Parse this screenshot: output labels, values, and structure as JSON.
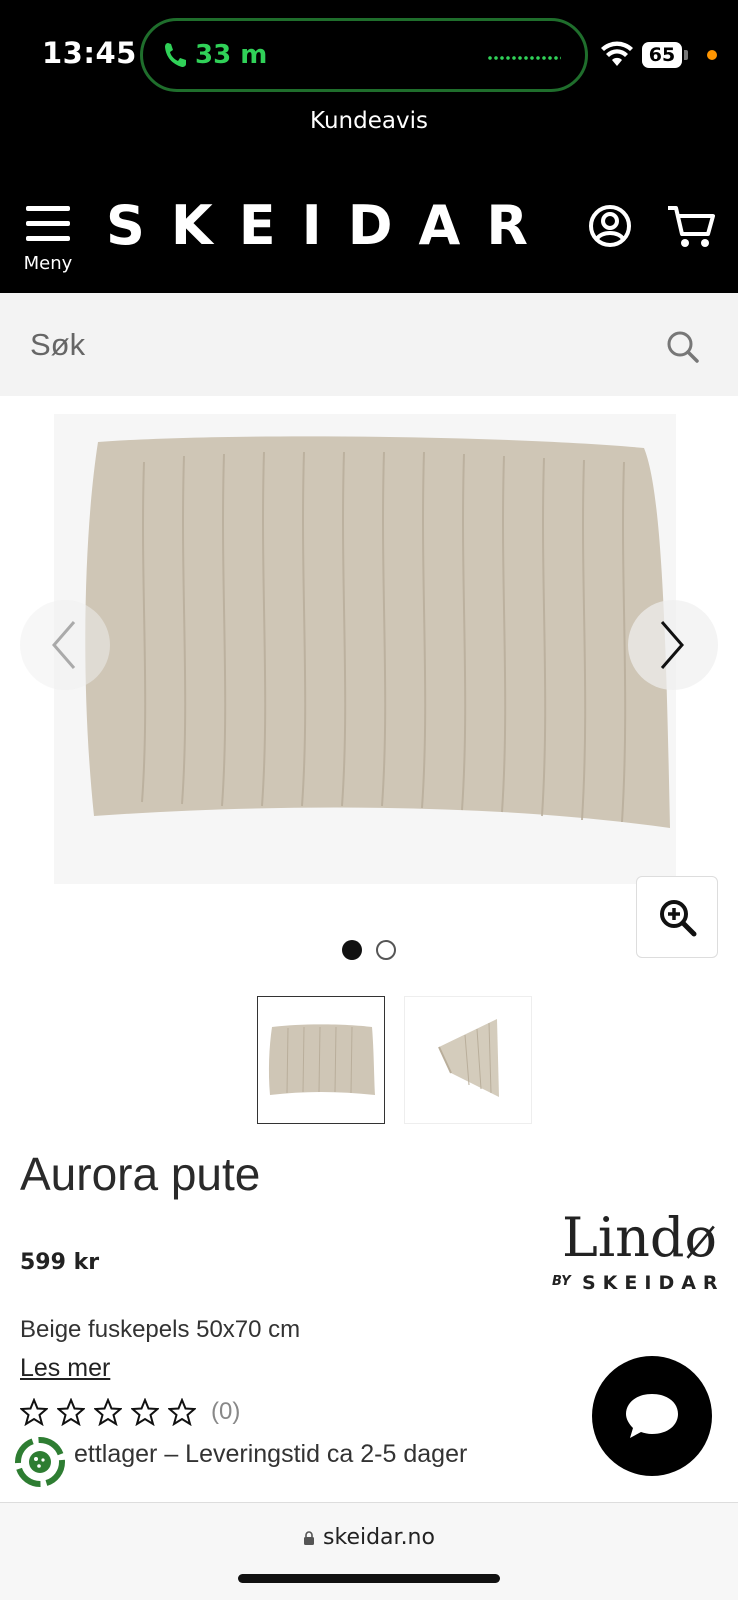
{
  "status_bar": {
    "time": "13:45",
    "call_duration": "33 m",
    "battery": "65",
    "accent_call_color": "#30d158"
  },
  "header": {
    "banner": "Kundeavis",
    "menu_label": "Meny",
    "logo": "SKEIDAR",
    "icons": [
      "menu-icon",
      "account-icon",
      "cart-icon"
    ]
  },
  "search": {
    "placeholder": "Søk",
    "icon": "search-icon"
  },
  "gallery": {
    "images": [
      "pillow-front",
      "pillow-corner"
    ],
    "active_index": 0,
    "icons": [
      "chevron-left-icon",
      "chevron-right-icon",
      "zoom-in-icon"
    ]
  },
  "product": {
    "title": "Aurora pute",
    "price": "599 kr",
    "brand": {
      "name": "Lindø",
      "by": "BY",
      "company": "SKEIDAR"
    },
    "description": "Beige fuskepels 50x70 cm",
    "read_more": "Les mer",
    "rating": {
      "stars": 0,
      "max": 5,
      "count_text": "(0)"
    },
    "stock": "ettlager – Leveringstid ca 2-5 dager"
  },
  "browser": {
    "url": "skeidar.no"
  }
}
